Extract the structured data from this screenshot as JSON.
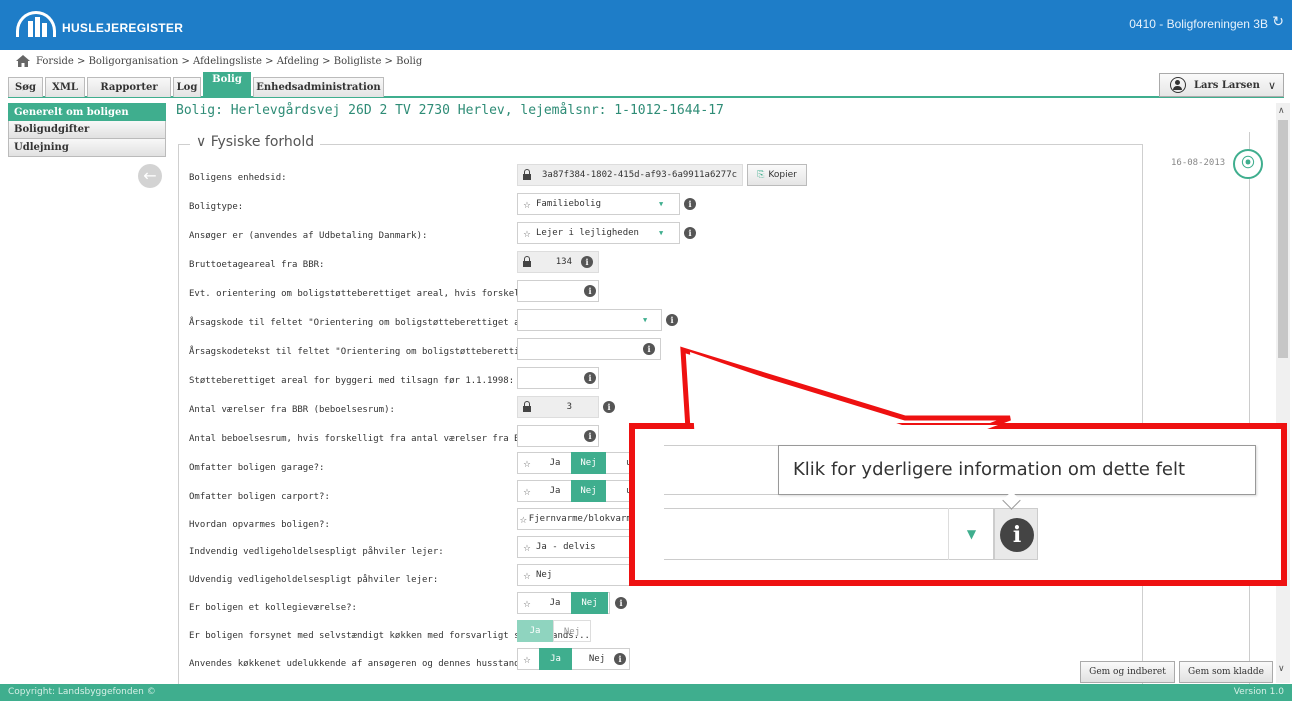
{
  "header": {
    "logo_text": "HUSLEJEREGISTER",
    "organisation": "0410 - Boligforeningen 3B"
  },
  "breadcrumb": "Forside > Boligorganisation > Afdelingsliste > Afdeling > Boligliste > Bolig",
  "tabs": [
    {
      "label": "Søg"
    },
    {
      "label": "XML"
    },
    {
      "label": "Rapporter"
    },
    {
      "label": "Log"
    },
    {
      "label": "Bolig"
    },
    {
      "label": "Enhedsadministration"
    }
  ],
  "user": {
    "name": "Lars Larsen"
  },
  "sidebar": {
    "items": [
      {
        "label": "Generelt om boligen"
      },
      {
        "label": "Boligudgifter"
      },
      {
        "label": "Udlejning"
      }
    ]
  },
  "page_title": "Bolig: Herlevgårdsvej 26D 2 TV 2730 Herlev, lejemålsnr: 1-1012-1644-17",
  "section_title": "Fysiske forhold",
  "fields": {
    "enhedsid": {
      "label": "Boligens enhedsid:",
      "value": "3a87f384-1802-415d-af93-6a9911a6277c"
    },
    "boligtype": {
      "label": "Boligtype:",
      "value": "Familiebolig"
    },
    "ansoeger": {
      "label": "Ansøger er (anvendes af Udbetaling Danmark):",
      "value": "Lejer i lejligheden"
    },
    "brutto": {
      "label": "Bruttoetageareal fra BBR:",
      "value": "134"
    },
    "orientering": {
      "label": "Evt. orientering om boligstøtteberettiget areal, hvis forskelligt fra BBR:"
    },
    "aarsagskode": {
      "label": "Årsagskode til feltet \"Orientering om boligstøtteberettiget areal\":"
    },
    "aarsagstekst": {
      "label": "Årsagskodetekst til feltet \"Orientering om boligstøtteberettiget areal\":"
    },
    "stoette": {
      "label": "Støtteberettiget areal for byggeri med tilsagn før 1.1.1998:"
    },
    "vaerelser": {
      "label": "Antal værelser fra BBR (beboelsesrum):",
      "value": "3"
    },
    "beboelse": {
      "label": "Antal beboelsesrum, hvis forskelligt fra antal værelser fra BBR (beboelse..."
    },
    "garage": {
      "label": "Omfatter boligen garage?:"
    },
    "carport": {
      "label": "Omfatter boligen carport?:"
    },
    "opvarmning": {
      "label": "Hvordan opvarmes boligen?:",
      "value": "Fjernvarme/blokvarmece"
    },
    "indvendig": {
      "label": "Indvendig vedligeholdelsespligt påhviler lejer:",
      "value": "Ja - delvis"
    },
    "udvendig": {
      "label": "Udvendig vedligeholdelsespligt påhviler lejer:",
      "value": "Nej"
    },
    "kollegie": {
      "label": "Er boligen et kollegieværelse?:"
    },
    "koekken": {
      "label": "Er boligen forsynet med selvstændigt køkken med forsvarligt spildevands..."
    },
    "koekken_brug": {
      "label": "Anvendes køkkenet udelukkende af ansøgeren og dennes husstand:"
    }
  },
  "labels": {
    "kopier": "Kopier",
    "ja": "Ja",
    "nej": "Nej",
    "ulig_fragment": "ulig"
  },
  "timeline": {
    "date": "16-08-2013"
  },
  "buttons": {
    "gem_indberet": "Gem og indberet",
    "gem_kladde": "Gem som kladde"
  },
  "footer": {
    "copyright": "Copyright: Landsbyggefonden ©",
    "version": "Version 1.0"
  },
  "tooltip": {
    "text": "Klik for yderligere information om dette felt"
  },
  "colors": {
    "header_blue": "#1e7dc8",
    "accent_green": "#3fae8e",
    "callout_red": "#ee1111"
  }
}
